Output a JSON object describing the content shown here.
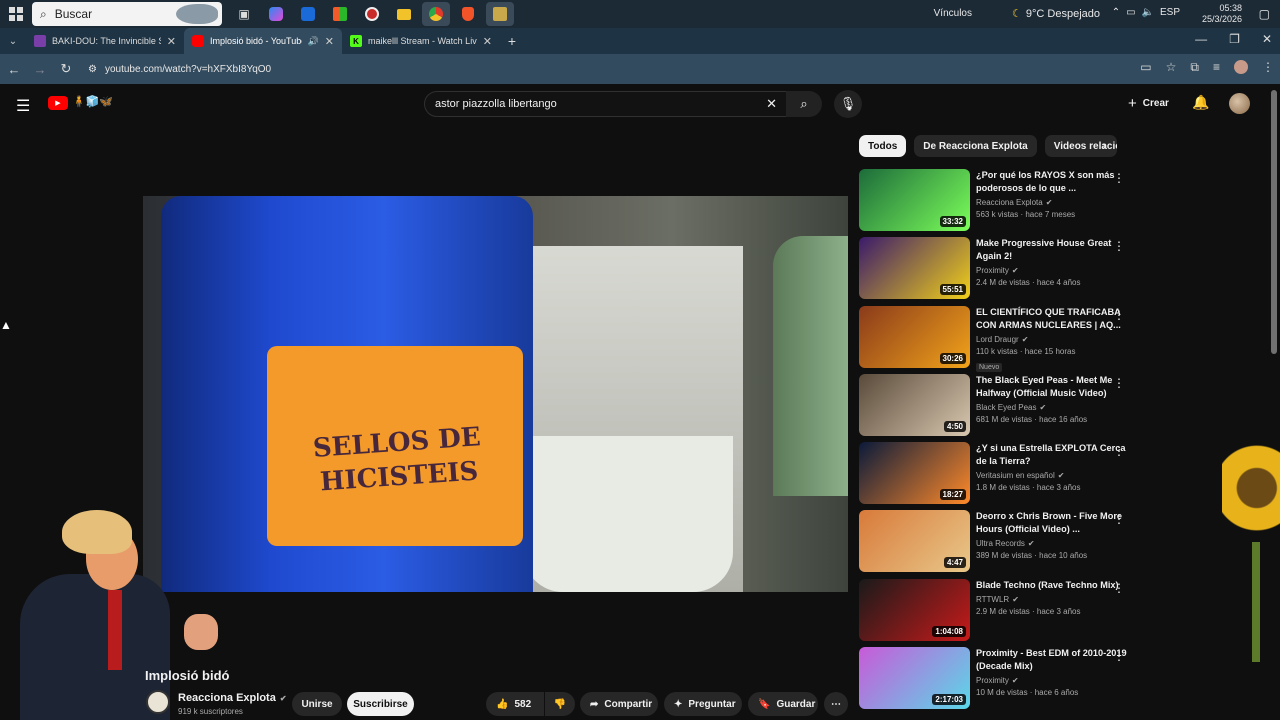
{
  "taskbar": {
    "search_placeholder": "Buscar",
    "links_label": "Vínculos",
    "weather": "9°C  Despejado",
    "language": "ESP",
    "time": "05:38",
    "date": "25/3/2026"
  },
  "tabs": [
    {
      "title": "BAKI-DOU: The Invincible Samu",
      "favicon_color": "#7a3ea8"
    },
    {
      "title": "Implosió bidó - YouTube",
      "favicon_color": "#ff0000"
    },
    {
      "title": "maikelll Stream - Watch Live on",
      "favicon_color": "#53fc18"
    }
  ],
  "address_bar": {
    "url": "youtube.com/watch?v=hXFXbI8YqO0"
  },
  "youtube": {
    "search_query": "astor piazzolla libertango",
    "create_label": "Crear",
    "video": {
      "title": "Implosió bidó",
      "overlay_text_line1": "SELLOS DE",
      "overlay_text_line2": "HICISTEIS",
      "channel": "Reacciona Explota",
      "subscribers": "919 k suscriptores",
      "join_label": "Unirse",
      "subscribe_label": "Suscribirse",
      "likes": "582",
      "share_label": "Compartir",
      "ask_label": "Preguntar",
      "save_label": "Guardar"
    },
    "chips": [
      "Todos",
      "De Reacciona Explota",
      "Videos relacionados"
    ],
    "recommendations": [
      {
        "title": "¿Por qué los RAYOS X son más poderosos de lo que ...",
        "channel": "Reacciona Explota",
        "verified": true,
        "stats": "563 k vistas · hace 7 meses",
        "duration": "33:32",
        "badge": "",
        "thumb_colors": [
          "#1c6b3a",
          "#7cff5a"
        ]
      },
      {
        "title": "Make Progressive House Great Again 2!",
        "channel": "Proximity",
        "verified": true,
        "stats": "2.4 M de vistas · hace 4 años",
        "duration": "55:51",
        "badge": "",
        "thumb_colors": [
          "#3a1a6b",
          "#f2d11a"
        ]
      },
      {
        "title": "EL CIENTÍFICO QUE TRAFICABA CON ARMAS NUCLEARES | AQ...",
        "channel": "Lord Draugr",
        "verified": true,
        "stats": "110 k vistas · hace 15 horas",
        "duration": "30:26",
        "badge": "Nuevo",
        "thumb_colors": [
          "#8a3a1a",
          "#f2a41a"
        ]
      },
      {
        "title": "The Black Eyed Peas - Meet Me Halfway (Official Music Video)",
        "channel": "Black Eyed Peas",
        "verified": true,
        "stats": "681 M de vistas · hace 16 años",
        "duration": "4:50",
        "badge": "",
        "thumb_colors": [
          "#5a4a3a",
          "#d8c8b0"
        ]
      },
      {
        "title": "¿Y si una Estrella EXPLOTA Cerca de la Tierra?",
        "channel": "Veritasium en español",
        "verified": true,
        "stats": "1.8 M de vistas · hace 3 años",
        "duration": "18:27",
        "badge": "",
        "thumb_colors": [
          "#0a1a3a",
          "#ff8a2a"
        ]
      },
      {
        "title": "Deorro x Chris Brown - Five More Hours (Official Video) ...",
        "channel": "Ultra Records",
        "verified": true,
        "stats": "389 M de vistas · hace 10 años",
        "duration": "4:47",
        "badge": "",
        "thumb_colors": [
          "#d87a3a",
          "#e8c88a"
        ]
      },
      {
        "title": "Blade Techno (Rave Techno Mix)",
        "channel": "RTTWLR",
        "verified": true,
        "stats": "2.9 M de vistas · hace 3 años",
        "duration": "1:04:08",
        "badge": "",
        "thumb_colors": [
          "#1a1a1a",
          "#c81a1a"
        ]
      },
      {
        "title": "Proximity - Best EDM of 2010-2019 (Decade Mix)",
        "channel": "Proximity",
        "verified": true,
        "stats": "10 M de vistas · hace 6 años",
        "duration": "2:17:03",
        "badge": "",
        "thumb_colors": [
          "#c85ad8",
          "#5ad8e8"
        ]
      }
    ]
  }
}
